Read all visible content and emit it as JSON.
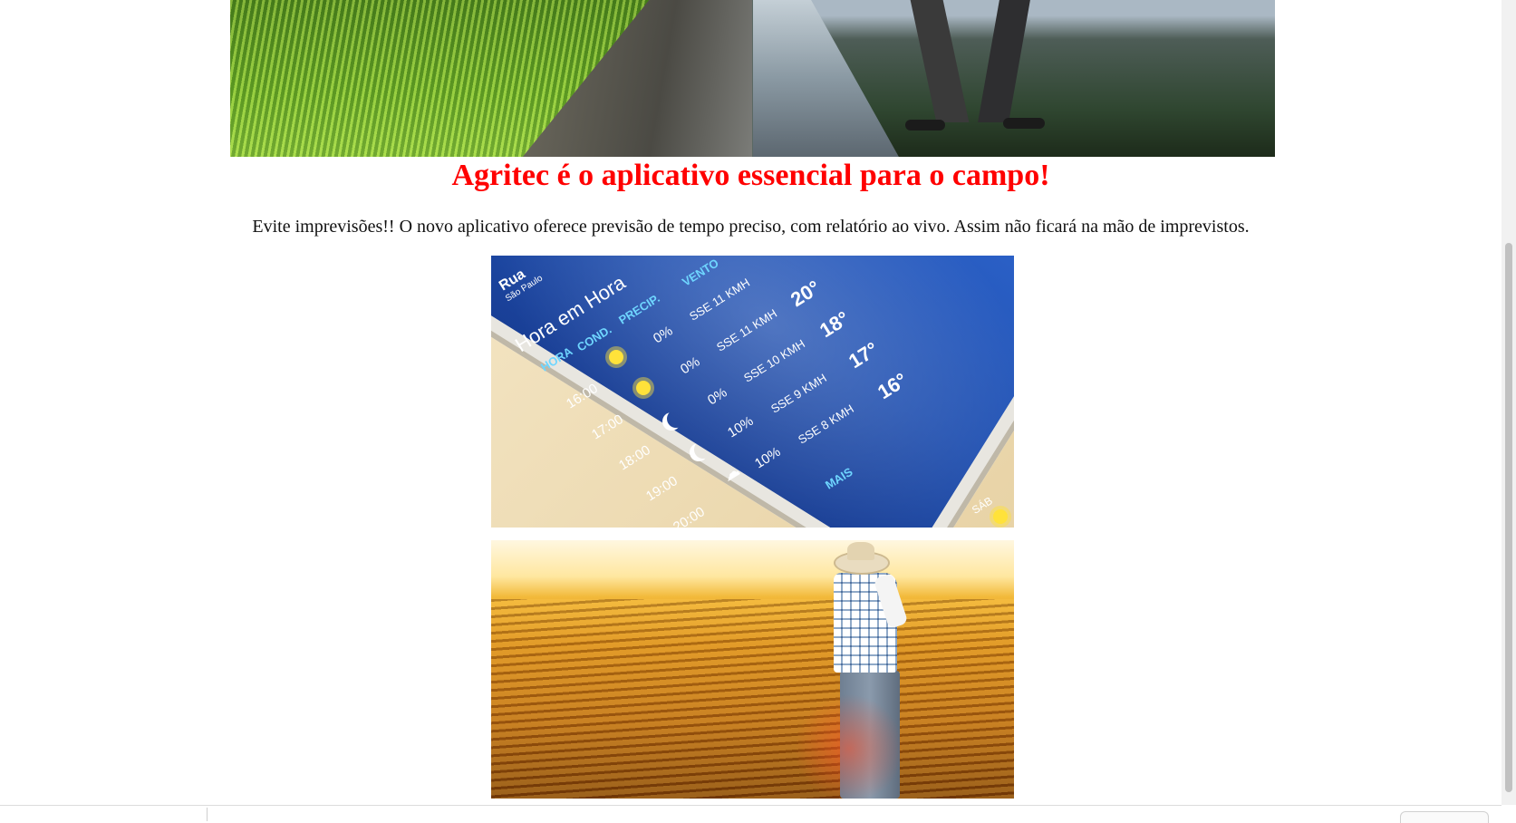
{
  "page": {
    "headline": "Agritec é o aplicativo essencial para o campo!",
    "intro": "Evite imprevisões!! O novo aplicativo oferece previsão de tempo preciso, com relatório ao vivo. Assim não ficará na mão de imprevistos."
  },
  "weather_screenshot": {
    "street": "Rua",
    "city": "São Paulo",
    "title": "Hora em Hora",
    "columns": [
      "HORA",
      "COND.",
      "PRECIP.",
      "VENTO"
    ],
    "rows": [
      {
        "hour": "16:00",
        "icon": "sun-icon",
        "precip": "0%",
        "wind": "SSE 11 KMH",
        "temp": "20°"
      },
      {
        "hour": "17:00",
        "icon": "sun-icon",
        "precip": "0%",
        "wind": "SSE 11 KMH",
        "temp": "18°"
      },
      {
        "hour": "18:00",
        "icon": "moon-icon",
        "precip": "0%",
        "wind": "SSE 10 KMH",
        "temp": "17°"
      },
      {
        "hour": "19:00",
        "icon": "moon-icon",
        "precip": "10%",
        "wind": "SSE 9 KMH",
        "temp": "16°"
      },
      {
        "hour": "20:00",
        "icon": "cloud-icon",
        "precip": "10%",
        "wind": "SSE 8 KMH",
        "temp": ""
      }
    ],
    "more_label": "MAIS",
    "day_label": "SÁB",
    "colors": {
      "screen": "#1f4fb0",
      "label": "#6fd6ff"
    }
  },
  "colors": {
    "headline": "#ff0000",
    "text": "#111111"
  }
}
